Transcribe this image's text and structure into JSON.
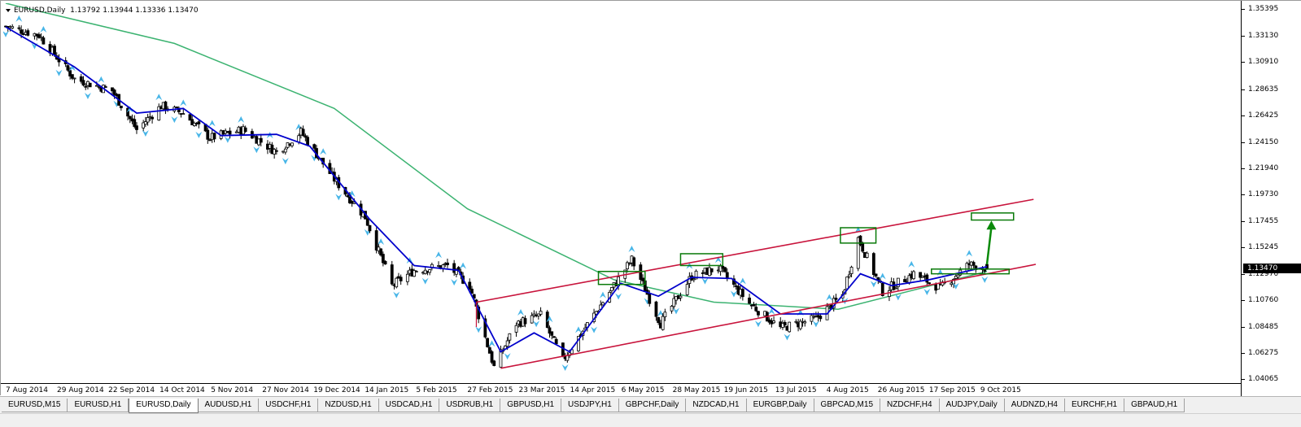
{
  "window": {
    "header": {
      "symbol_timeframe": "EURUSD,Daily",
      "ohlc": "1.13792 1.13944 1.13336 1.13470"
    }
  },
  "price_scale": {
    "labels": [
      "1.35395",
      "1.33130",
      "1.30910",
      "1.28635",
      "1.26425",
      "1.24150",
      "1.21940",
      "1.19730",
      "1.17455",
      "1.15245",
      "1.12970",
      "1.10760",
      "1.08485",
      "1.06275",
      "1.04065"
    ],
    "current_price": "1.13470"
  },
  "time_scale": {
    "labels": [
      "7 Aug 2014",
      "29 Aug 2014",
      "22 Sep 2014",
      "14 Oct 2014",
      "5 Nov 2014",
      "27 Nov 2014",
      "19 Dec 2014",
      "14 Jan 2015",
      "5 Feb 2015",
      "27 Feb 2015",
      "23 Mar 2015",
      "14 Apr 2015",
      "6 May 2015",
      "28 May 2015",
      "19 Jun 2015",
      "13 Jul 2015",
      "4 Aug 2015",
      "26 Aug 2015",
      "17 Sep 2015",
      "9 Oct 2015"
    ]
  },
  "tabs": [
    {
      "label": "EURUSD,M15",
      "active": false
    },
    {
      "label": "EURUSD,H1",
      "active": false
    },
    {
      "label": "EURUSD,Daily",
      "active": true
    },
    {
      "label": "AUDUSD,H1",
      "active": false
    },
    {
      "label": "USDCHF,H1",
      "active": false
    },
    {
      "label": "NZDUSD,H1",
      "active": false
    },
    {
      "label": "USDCAD,H1",
      "active": false
    },
    {
      "label": "USDRUB,H1",
      "active": false
    },
    {
      "label": "GBPUSD,H1",
      "active": false
    },
    {
      "label": "USDJPY,H1",
      "active": false
    },
    {
      "label": "GBPCHF,Daily",
      "active": false
    },
    {
      "label": "NZDCAD,H1",
      "active": false
    },
    {
      "label": "EURGBP,Daily",
      "active": false
    },
    {
      "label": "GBPCAD,M15",
      "active": false
    },
    {
      "label": "NZDCHF,H4",
      "active": false
    },
    {
      "label": "AUDJPY,Daily",
      "active": false
    },
    {
      "label": "AUDNZD,H4",
      "active": false
    },
    {
      "label": "EURCHF,H1",
      "active": false
    },
    {
      "label": "GBPAUD,H1",
      "active": false
    }
  ],
  "colors": {
    "candle": "#000000",
    "fast_ma": "#0000cc",
    "slow_ma": "#3cb371",
    "channel": "#c8143c",
    "zones": "#0a7a0a",
    "fractal": "#49b6e8",
    "arrow": "#0a8a0a"
  },
  "chart_data": {
    "type": "candlestick",
    "symbol": "EURUSD",
    "timeframe": "Daily",
    "ylim": [
      1.0375,
      1.359
    ],
    "x_range": [
      "2014-08-05",
      "2015-10-21"
    ],
    "last": {
      "open": 1.13792,
      "high": 1.13944,
      "low": 1.13336,
      "close": 1.1347
    },
    "close_path": [
      [
        "2014-08-05",
        1.3395
      ],
      [
        "2014-08-20",
        1.332
      ],
      [
        "2014-09-05",
        1.295
      ],
      [
        "2014-09-22",
        1.285
      ],
      [
        "2014-10-03",
        1.252
      ],
      [
        "2014-10-14",
        1.272
      ],
      [
        "2014-10-24",
        1.266
      ],
      [
        "2014-11-05",
        1.245
      ],
      [
        "2014-11-20",
        1.252
      ],
      [
        "2014-12-05",
        1.233
      ],
      [
        "2014-12-16",
        1.25
      ],
      [
        "2014-12-31",
        1.21
      ],
      [
        "2015-01-14",
        1.178
      ],
      [
        "2015-01-26",
        1.12
      ],
      [
        "2015-02-05",
        1.133
      ],
      [
        "2015-02-20",
        1.137
      ],
      [
        "2015-03-02",
        1.12
      ],
      [
        "2015-03-13",
        1.051
      ],
      [
        "2015-03-23",
        1.088
      ],
      [
        "2015-04-03",
        1.095
      ],
      [
        "2015-04-13",
        1.057
      ],
      [
        "2015-04-28",
        1.098
      ],
      [
        "2015-05-14",
        1.142
      ],
      [
        "2015-05-27",
        1.088
      ],
      [
        "2015-06-10",
        1.128
      ],
      [
        "2015-06-22",
        1.135
      ],
      [
        "2015-07-06",
        1.105
      ],
      [
        "2015-07-20",
        1.084
      ],
      [
        "2015-08-05",
        1.092
      ],
      [
        "2015-08-17",
        1.112
      ],
      [
        "2015-08-24",
        1.16
      ],
      [
        "2015-09-04",
        1.115
      ],
      [
        "2015-09-18",
        1.13
      ],
      [
        "2015-09-30",
        1.118
      ],
      [
        "2015-10-13",
        1.138
      ],
      [
        "2015-10-21",
        1.1347
      ]
    ],
    "fast_ma_path": [
      [
        "2014-08-05",
        1.339
      ],
      [
        "2014-09-05",
        1.305
      ],
      [
        "2014-10-03",
        1.266
      ],
      [
        "2014-10-24",
        1.27
      ],
      [
        "2014-11-10",
        1.247
      ],
      [
        "2014-12-05",
        1.248
      ],
      [
        "2014-12-20",
        1.238
      ],
      [
        "2015-01-16",
        1.176
      ],
      [
        "2015-02-05",
        1.137
      ],
      [
        "2015-02-25",
        1.133
      ],
      [
        "2015-03-16",
        1.064
      ],
      [
        "2015-03-31",
        1.08
      ],
      [
        "2015-04-16",
        1.064
      ],
      [
        "2015-05-09",
        1.122
      ],
      [
        "2015-05-26",
        1.111
      ],
      [
        "2015-06-10",
        1.127
      ],
      [
        "2015-06-28",
        1.126
      ],
      [
        "2015-07-20",
        1.096
      ],
      [
        "2015-08-10",
        1.096
      ],
      [
        "2015-08-25",
        1.13
      ],
      [
        "2015-09-08",
        1.12
      ],
      [
        "2015-09-25",
        1.125
      ],
      [
        "2015-10-21",
        1.136
      ]
    ],
    "slow_ma_path": [
      [
        "2014-08-05",
        1.359
      ],
      [
        "2014-10-20",
        1.325
      ],
      [
        "2014-12-31",
        1.27
      ],
      [
        "2015-03-01",
        1.185
      ],
      [
        "2015-05-06",
        1.125
      ],
      [
        "2015-06-20",
        1.106
      ],
      [
        "2015-08-15",
        1.1
      ],
      [
        "2015-10-21",
        1.132
      ]
    ],
    "channel_lines": [
      {
        "from": [
          "2015-03-05",
          1.106
        ],
        "to": [
          "2015-11-11",
          1.193
        ]
      },
      {
        "from": [
          "2015-03-16",
          1.05
        ],
        "to": [
          "2015-11-12",
          1.138
        ]
      }
    ],
    "zones": [
      {
        "x": [
          "2015-04-29",
          "2015-05-20"
        ],
        "y": [
          1.121,
          1.132
        ]
      },
      {
        "x": [
          "2015-06-05",
          "2015-06-24"
        ],
        "y": [
          1.137,
          1.147
        ]
      },
      {
        "x": [
          "2015-08-16",
          "2015-09-01"
        ],
        "y": [
          1.156,
          1.169
        ]
      },
      {
        "x": [
          "2015-09-26",
          "2015-10-31"
        ],
        "y": [
          1.13,
          1.134
        ]
      },
      {
        "x": [
          "2015-10-14",
          "2015-11-02"
        ],
        "y": [
          1.1755,
          1.1815
        ]
      }
    ],
    "arrow": {
      "from": [
        "2015-10-21",
        1.138
      ],
      "to": [
        "2015-10-23",
        1.175
      ]
    }
  }
}
